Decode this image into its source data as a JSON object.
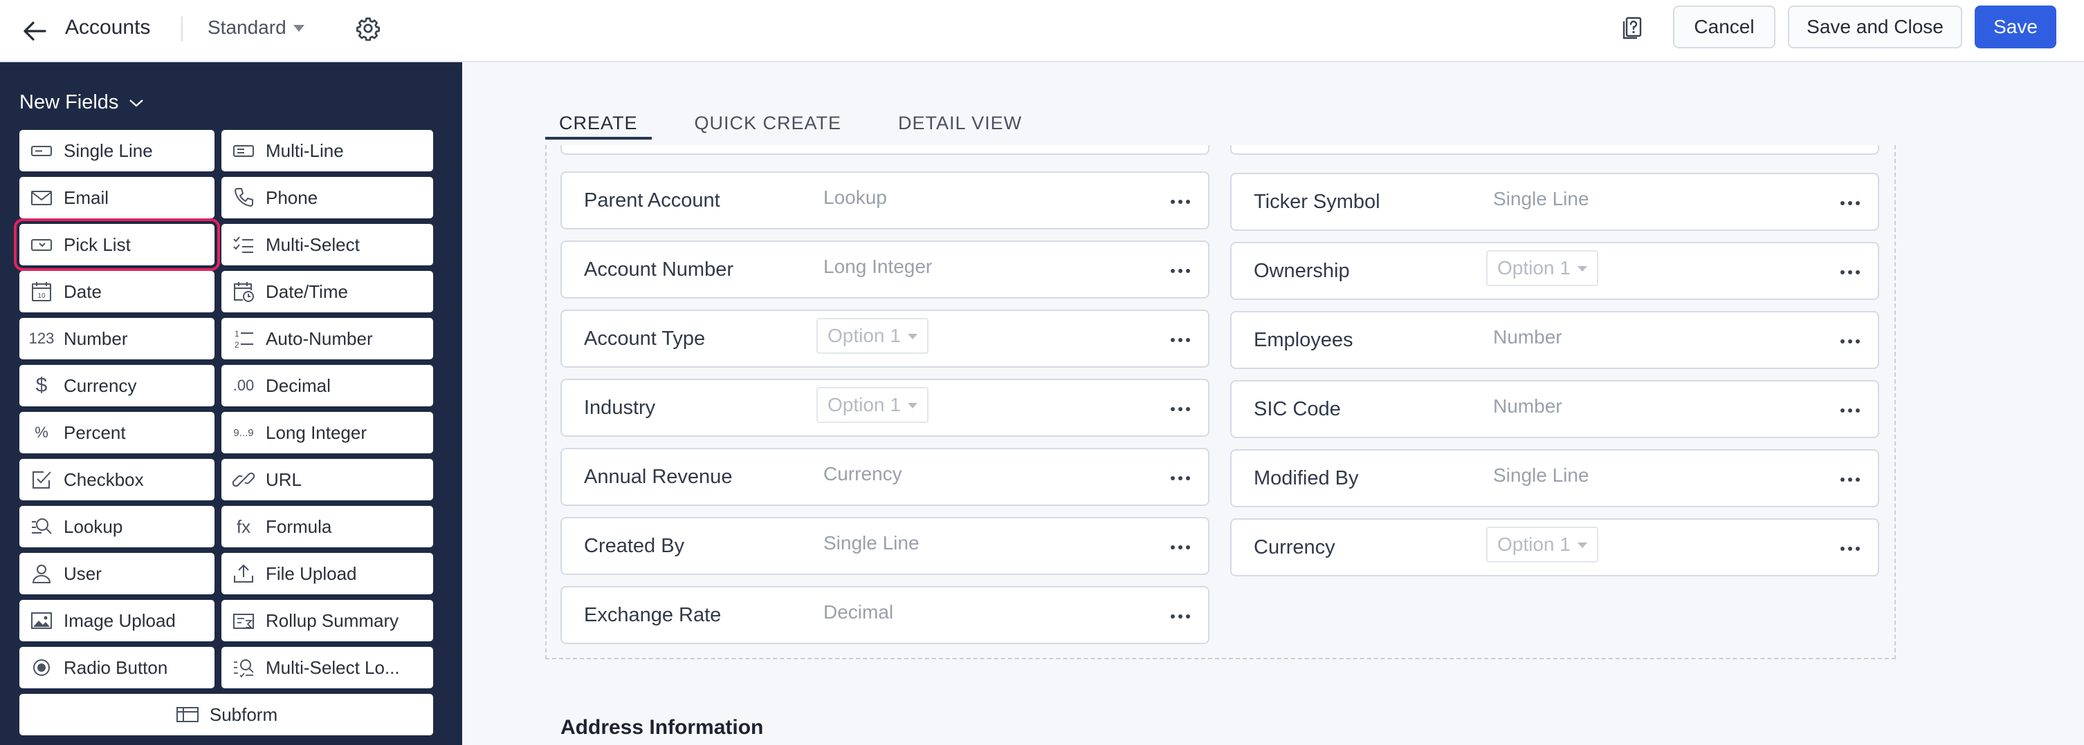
{
  "header": {
    "module_title": "Accounts",
    "layout_name": "Standard",
    "buttons": {
      "cancel": "Cancel",
      "save_close": "Save and Close",
      "save": "Save"
    },
    "icons": {
      "back": "arrow-left-icon",
      "settings": "gear-icon",
      "help": "document-help-icon"
    }
  },
  "sidebar": {
    "heading": "New Fields",
    "items": [
      {
        "label": "Single Line",
        "icon": "single-line-icon"
      },
      {
        "label": "Multi-Line",
        "icon": "multi-line-icon"
      },
      {
        "label": "Email",
        "icon": "email-icon"
      },
      {
        "label": "Phone",
        "icon": "phone-icon"
      },
      {
        "label": "Pick List",
        "icon": "picklist-icon",
        "highlighted": true
      },
      {
        "label": "Multi-Select",
        "icon": "checklist-icon"
      },
      {
        "label": "Date",
        "icon": "calendar-icon",
        "glyph": "10"
      },
      {
        "label": "Date/Time",
        "icon": "calendar-clock-icon"
      },
      {
        "label": "Number",
        "icon": "number-icon",
        "glyph": "123"
      },
      {
        "label": "Auto-Number",
        "icon": "auto-number-icon",
        "glyph": "1‘2"
      },
      {
        "label": "Currency",
        "icon": "dollar-icon",
        "glyph": "$"
      },
      {
        "label": "Decimal",
        "icon": "decimal-icon",
        "glyph": ".00"
      },
      {
        "label": "Percent",
        "icon": "percent-icon",
        "glyph": "%"
      },
      {
        "label": "Long Integer",
        "icon": "long-integer-icon",
        "glyph": "9...9"
      },
      {
        "label": "Checkbox",
        "icon": "checkbox-icon"
      },
      {
        "label": "URL",
        "icon": "link-icon"
      },
      {
        "label": "Lookup",
        "icon": "lookup-icon"
      },
      {
        "label": "Formula",
        "icon": "formula-icon",
        "glyph": "fx"
      },
      {
        "label": "User",
        "icon": "user-icon"
      },
      {
        "label": "File Upload",
        "icon": "upload-icon"
      },
      {
        "label": "Image Upload",
        "icon": "image-icon"
      },
      {
        "label": "Rollup Summary",
        "icon": "rollup-icon"
      },
      {
        "label": "Radio Button",
        "icon": "radio-icon"
      },
      {
        "label": "Multi-Select Lo...",
        "icon": "multi-lookup-icon"
      }
    ],
    "subform": {
      "label": "Subform",
      "icon": "table-icon"
    }
  },
  "tabs": [
    "CREATE",
    "QUICK CREATE",
    "DETAIL VIEW"
  ],
  "fields_left": [
    {
      "label": "Parent Account",
      "type": "Lookup"
    },
    {
      "label": "Account Number",
      "type": "Long Integer"
    },
    {
      "label": "Account Type",
      "option": "Option 1"
    },
    {
      "label": "Industry",
      "option": "Option 1"
    },
    {
      "label": "Annual Revenue",
      "type": "Currency"
    },
    {
      "label": "Created By",
      "type": "Single Line"
    },
    {
      "label": "Exchange Rate",
      "type": "Decimal"
    }
  ],
  "fields_right": [
    {
      "label": "Ticker Symbol",
      "type": "Single Line"
    },
    {
      "label": "Ownership",
      "option": "Option 1"
    },
    {
      "label": "Employees",
      "type": "Number"
    },
    {
      "label": "SIC Code",
      "type": "Number"
    },
    {
      "label": "Modified By",
      "type": "Single Line"
    },
    {
      "label": "Currency",
      "option": "Option 1"
    }
  ],
  "section_title": "Address Information",
  "colors": {
    "sidebar_bg": "#1e2a45",
    "primary": "#2f5fe0",
    "highlight": "#e0245e"
  }
}
